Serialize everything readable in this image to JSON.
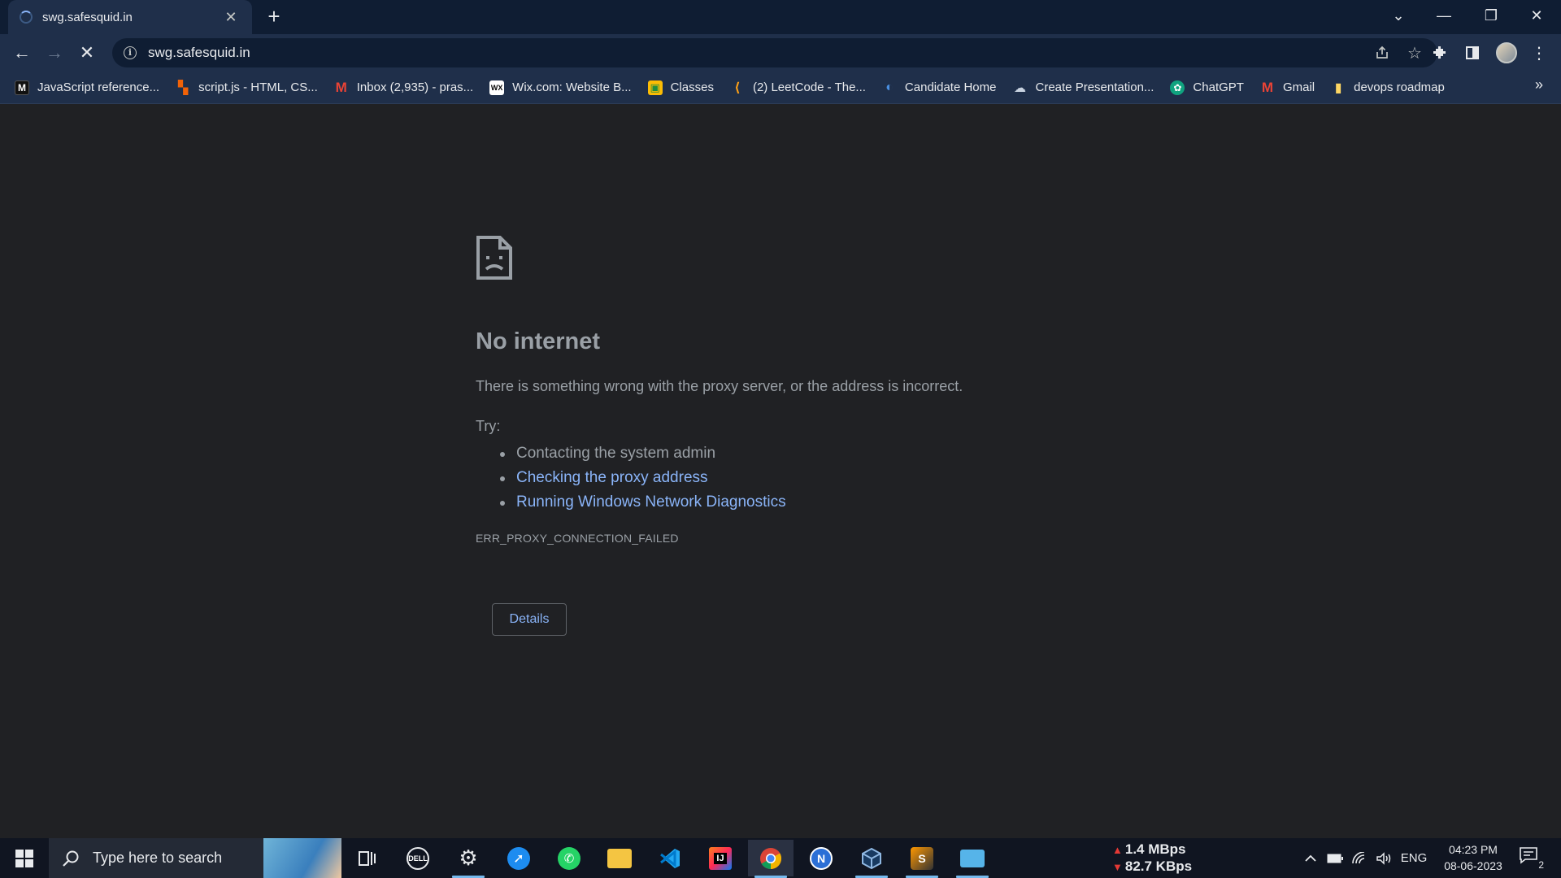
{
  "tab": {
    "title": "swg.safesquid.in",
    "close": "✕",
    "new_tab": "+"
  },
  "window_controls": {
    "tab_search": "⌄",
    "minimize": "—",
    "restore": "❐",
    "close": "✕"
  },
  "toolbar": {
    "back": "←",
    "forward": "→",
    "reload": "✕",
    "url": "swg.safesquid.in"
  },
  "bookmarks": [
    {
      "label": "JavaScript reference...",
      "icon": "M",
      "color": "#111111"
    },
    {
      "label": "script.js - HTML, CS...",
      "icon": "▚",
      "color": "#f26207"
    },
    {
      "label": "Inbox (2,935) - pras...",
      "icon": "M",
      "color": "#ea4335"
    },
    {
      "label": "Wix.com: Website B...",
      "icon": "WX",
      "color": "#ffffff"
    },
    {
      "label": "Classes",
      "icon": "▣",
      "color": "#1e8e3e"
    },
    {
      "label": "(2) LeetCode - The...",
      "icon": "⟨",
      "color": "#ffa116"
    },
    {
      "label": "Candidate Home",
      "icon": "◐",
      "color": "#1a73e8"
    },
    {
      "label": "Create Presentation...",
      "icon": "☁",
      "color": "#6d7fa0"
    },
    {
      "label": "ChatGPT",
      "icon": "✿",
      "color": "#10a37f"
    },
    {
      "label": "Gmail",
      "icon": "M",
      "color": "#ea4335"
    },
    {
      "label": "devops roadmap",
      "icon": "▮",
      "color": "#fdd663"
    }
  ],
  "bookmarks_more": "»",
  "error": {
    "title": "No internet",
    "message": "There is something wrong with the proxy server, or the address is incorrect.",
    "try_label": "Try:",
    "suggestions": [
      {
        "text": "Contacting the system admin",
        "link": false
      },
      {
        "text": "Checking the proxy address",
        "link": true
      },
      {
        "text": "Running Windows Network Diagnostics",
        "link": true
      }
    ],
    "code": "ERR_PROXY_CONNECTION_FAILED",
    "details_button": "Details"
  },
  "taskbar": {
    "search_placeholder": "Type here to search",
    "network_up": "1.4 MBps",
    "network_down": "82.7 KBps",
    "language": "ENG",
    "time": "04:23 PM",
    "date": "08-06-2023",
    "notification_count": "2"
  }
}
